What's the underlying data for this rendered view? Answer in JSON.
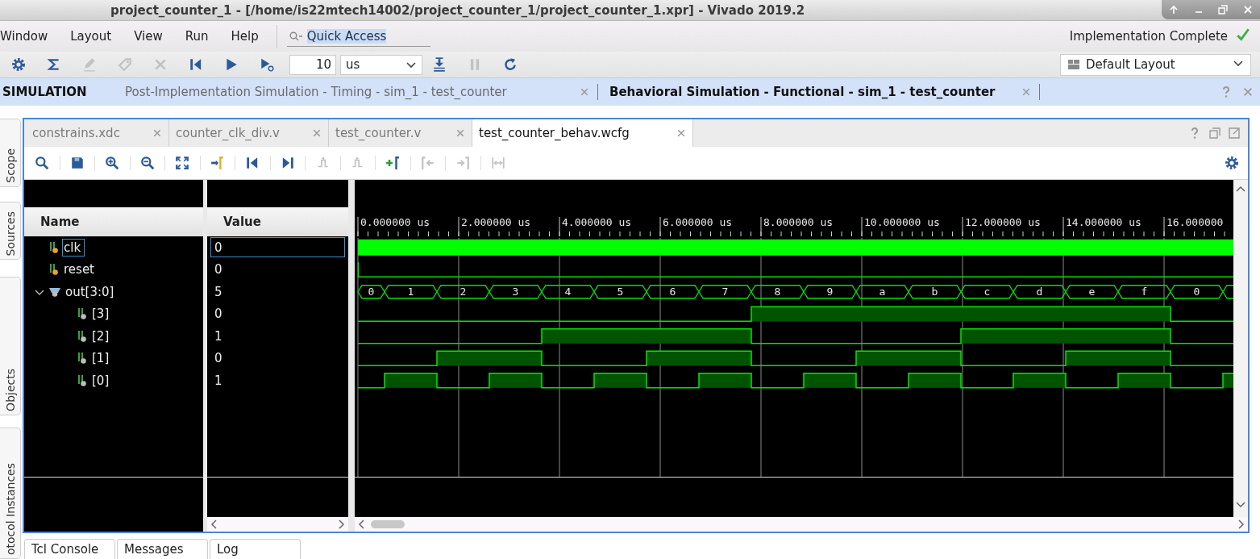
{
  "window": {
    "title": "project_counter_1 - [/home/is22mtech14002/project_counter_1/project_counter_1.xpr] - Vivado 2019.2"
  },
  "menu": [
    "Window",
    "Layout",
    "View",
    "Run",
    "Help"
  ],
  "quick_access": {
    "value": "Quick Access"
  },
  "status": {
    "text": "Implementation Complete",
    "complete": true
  },
  "toolbar": [
    {
      "kind": "settings",
      "disabled": false
    },
    {
      "kind": "sigma",
      "disabled": false
    },
    {
      "kind": "pencil",
      "disabled": true
    },
    {
      "kind": "tag",
      "disabled": true
    },
    {
      "kind": "cross",
      "disabled": true
    },
    {
      "kind": "first",
      "disabled": false
    },
    {
      "kind": "play",
      "disabled": false
    },
    {
      "kind": "play-timed",
      "disabled": false
    },
    {
      "kind": "run-time",
      "value": "10",
      "unit": "us"
    },
    {
      "kind": "step-down",
      "disabled": false
    },
    {
      "kind": "pause",
      "disabled": true
    },
    {
      "kind": "refresh",
      "disabled": false
    }
  ],
  "layout_selector": {
    "value": "Default Layout"
  },
  "simulation": {
    "label": "SIMULATION",
    "tabs": [
      {
        "label": "Post-Implementation Simulation - Timing - sim_1 - test_counter",
        "selected": false
      },
      {
        "label": "Behavioral Simulation - Functional - sim_1 - test_counter",
        "selected": true
      }
    ]
  },
  "side_tabs": [
    "Scope",
    "Sources",
    "Objects",
    "otocol Instances"
  ],
  "editor_tabs": [
    {
      "label": "constrains.xdc",
      "selected": false
    },
    {
      "label": "counter_clk_div.v",
      "selected": false
    },
    {
      "label": "test_counter.v",
      "selected": false
    },
    {
      "label": "test_counter_behav.wcfg",
      "selected": true
    }
  ],
  "wave_toolbar": [
    {
      "kind": "search",
      "disabled": false
    },
    {
      "kind": "save",
      "disabled": false
    },
    {
      "kind": "zoom-in",
      "disabled": false
    },
    {
      "kind": "zoom-out",
      "disabled": false
    },
    {
      "kind": "fit",
      "disabled": false
    },
    {
      "kind": "go-cursor",
      "disabled": false
    },
    {
      "kind": "first",
      "disabled": false
    },
    {
      "kind": "last",
      "disabled": false
    },
    {
      "kind": "prev-edge",
      "disabled": true
    },
    {
      "kind": "next-edge",
      "disabled": true
    },
    {
      "kind": "add-marker",
      "disabled": false
    },
    {
      "kind": "prev-marker",
      "disabled": true
    },
    {
      "kind": "next-marker",
      "disabled": true
    },
    {
      "kind": "swap-markers",
      "disabled": true
    },
    {
      "kind": "settings",
      "disabled": false
    }
  ],
  "wave": {
    "columns": [
      "Name",
      "Value"
    ],
    "ticks": [
      "0.000000 us",
      "2.000000 us",
      "4.000000 us",
      "6.000000 us",
      "8.000000 us",
      "10.000000 us",
      "12.000000 us",
      "14.000000 us",
      "16.000000"
    ],
    "signals": [
      {
        "name": "clk",
        "value": "0",
        "kind": "clock",
        "selected": true
      },
      {
        "name": "reset",
        "value": "0",
        "kind": "port",
        "selected": false
      },
      {
        "name": "out[3:0]",
        "value": "5",
        "kind": "bus",
        "selected": false,
        "expanded": true,
        "segments": [
          "0",
          "1",
          "2",
          "3",
          "4",
          "5",
          "6",
          "7",
          "8",
          "9",
          "a",
          "b",
          "c",
          "d",
          "e",
          "f",
          "0"
        ],
        "children": [
          {
            "name": "[3]",
            "value": "0",
            "kind": "bit",
            "selected": false
          },
          {
            "name": "[2]",
            "value": "1",
            "kind": "bit",
            "selected": false
          },
          {
            "name": "[1]",
            "value": "0",
            "kind": "bit",
            "selected": false
          },
          {
            "name": "[0]",
            "value": "1",
            "kind": "bit",
            "selected": false
          }
        ]
      }
    ]
  },
  "bottom_tabs": [
    "Tcl Console",
    "Messages",
    "Log"
  ]
}
